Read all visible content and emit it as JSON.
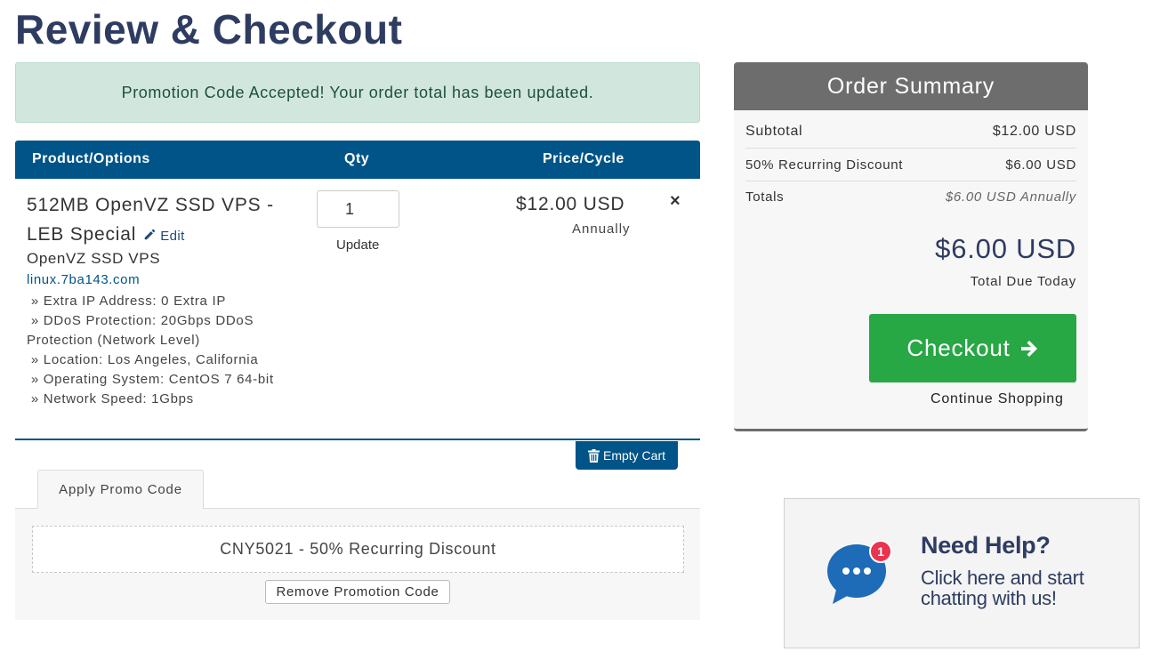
{
  "page": {
    "title": "Review & Checkout"
  },
  "alert": {
    "message": "Promotion Code Accepted! Your order total has been updated."
  },
  "cart": {
    "headers": {
      "product": "Product/Options",
      "qty": "Qty",
      "price": "Price/Cycle"
    },
    "item": {
      "title": "512MB OpenVZ SSD VPS - LEB Special",
      "edit_label": "Edit",
      "group": "OpenVZ SSD VPS",
      "domain": "linux.7ba143.com",
      "options": [
        "Extra IP Address: 0 Extra IP",
        "DDoS Protection: 20Gbps DDoS Protection (Network Level)",
        "Location: Los Angeles, California",
        "Operating System: CentOS 7 64-bit",
        "Network Speed: 1Gbps"
      ],
      "qty": "1",
      "update_label": "Update",
      "price": "$12.00 USD",
      "cycle": "Annually",
      "remove_symbol": "×"
    },
    "empty_cart_label": "Empty Cart"
  },
  "promo": {
    "tab_label": "Apply Promo Code",
    "applied": "CNY5021 - 50% Recurring Discount",
    "remove_label": "Remove Promotion Code"
  },
  "summary": {
    "title": "Order Summary",
    "subtotal_label": "Subtotal",
    "subtotal_value": "$12.00 USD",
    "discount_label": "50% Recurring Discount",
    "discount_value": "$6.00 USD",
    "totals_label": "Totals",
    "totals_value": "$6.00 USD Annually",
    "total_due": "$6.00 USD",
    "total_due_label": "Total Due Today",
    "checkout_label": "Checkout",
    "continue_label": "Continue Shopping"
  },
  "help": {
    "badge_count": "1",
    "title": "Need Help?",
    "line1": "Click here and start",
    "line2": "chatting with us!"
  },
  "icons": {
    "edit": "pencil-icon",
    "remove": "close-icon",
    "empty_cart": "trash-icon",
    "checkout": "arrow-right-icon",
    "chat": "chat-bubble-icon"
  },
  "colors": {
    "title": "#2e3c61",
    "header_bg": "#005487",
    "alert_bg": "#d1e7dd",
    "summary_head": "#6d6d6d",
    "checkout_btn": "#28a745",
    "chat_icon": "#1e6bb8",
    "badge": "#e8344e"
  }
}
